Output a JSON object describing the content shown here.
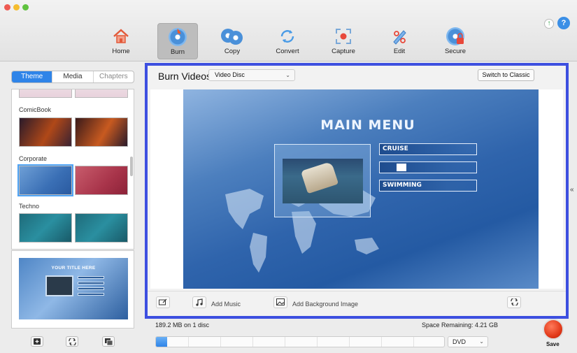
{
  "toolbar": {
    "items": [
      {
        "label": "Home",
        "icon": "home-icon"
      },
      {
        "label": "Burn",
        "icon": "burn-disc-icon",
        "active": true
      },
      {
        "label": "Copy",
        "icon": "copy-disc-icon"
      },
      {
        "label": "Convert",
        "icon": "convert-icon"
      },
      {
        "label": "Capture",
        "icon": "capture-icon"
      },
      {
        "label": "Edit",
        "icon": "edit-icon"
      },
      {
        "label": "Secure",
        "icon": "secure-disc-icon"
      }
    ],
    "update_icon": "up-arrow-icon",
    "help_label": "?"
  },
  "left_panel": {
    "tabs": [
      {
        "label": "Theme",
        "active": true
      },
      {
        "label": "Media"
      },
      {
        "label": "Chapters"
      }
    ],
    "themes": [
      {
        "name": "ComicBook"
      },
      {
        "name": "Corporate"
      },
      {
        "name": "Techno"
      }
    ],
    "preview": {
      "title": "YOUR TITLE HERE"
    }
  },
  "main": {
    "title": "Burn Videos",
    "disc_type": "Video Disc",
    "switch_button": "Switch to Classic",
    "menu": {
      "title": "MAIN MENU",
      "buttons": [
        "CRUISE",
        "",
        "SWIMMING"
      ]
    },
    "bottom": {
      "add_music": "Add Music",
      "add_background": "Add Background Image"
    }
  },
  "status": {
    "size": "189.2 MB on 1 disc",
    "space_remaining": "Space Remaining: 4.21 GB",
    "disc_format": "DVD",
    "progress_fraction": 0.04,
    "save_label": "Save"
  },
  "colors": {
    "accent": "#2f84e8",
    "highlight_frame": "#3d4fe0",
    "save": "#e23a1a"
  }
}
